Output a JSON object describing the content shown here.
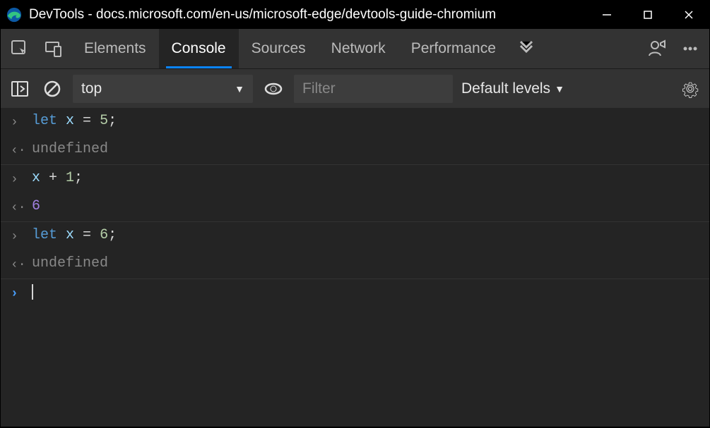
{
  "titlebar": {
    "title": "DevTools - docs.microsoft.com/en-us/microsoft-edge/devtools-guide-chromium"
  },
  "tabs": [
    {
      "label": "Elements",
      "active": false
    },
    {
      "label": "Console",
      "active": true
    },
    {
      "label": "Sources",
      "active": false
    },
    {
      "label": "Network",
      "active": false
    },
    {
      "label": "Performance",
      "active": false
    }
  ],
  "toolbar": {
    "context": "top",
    "filter_placeholder": "Filter",
    "levels_label": "Default levels"
  },
  "entries": [
    {
      "type": "input",
      "tokens": [
        [
          "key",
          "let"
        ],
        [
          "op",
          " "
        ],
        [
          "var",
          "x"
        ],
        [
          "op",
          " = "
        ],
        [
          "num",
          "5"
        ],
        [
          "op",
          ";"
        ]
      ]
    },
    {
      "type": "output",
      "tokens": [
        [
          "und",
          "undefined"
        ]
      ]
    },
    {
      "type": "input",
      "tokens": [
        [
          "var",
          "x"
        ],
        [
          "op",
          " + "
        ],
        [
          "num",
          "1"
        ],
        [
          "op",
          ";"
        ]
      ]
    },
    {
      "type": "output",
      "tokens": [
        [
          "res",
          "6"
        ]
      ]
    },
    {
      "type": "input",
      "tokens": [
        [
          "key",
          "let"
        ],
        [
          "op",
          " "
        ],
        [
          "var",
          "x"
        ],
        [
          "op",
          " = "
        ],
        [
          "num",
          "6"
        ],
        [
          "op",
          ";"
        ]
      ]
    },
    {
      "type": "output",
      "tokens": [
        [
          "und",
          "undefined"
        ]
      ]
    }
  ]
}
